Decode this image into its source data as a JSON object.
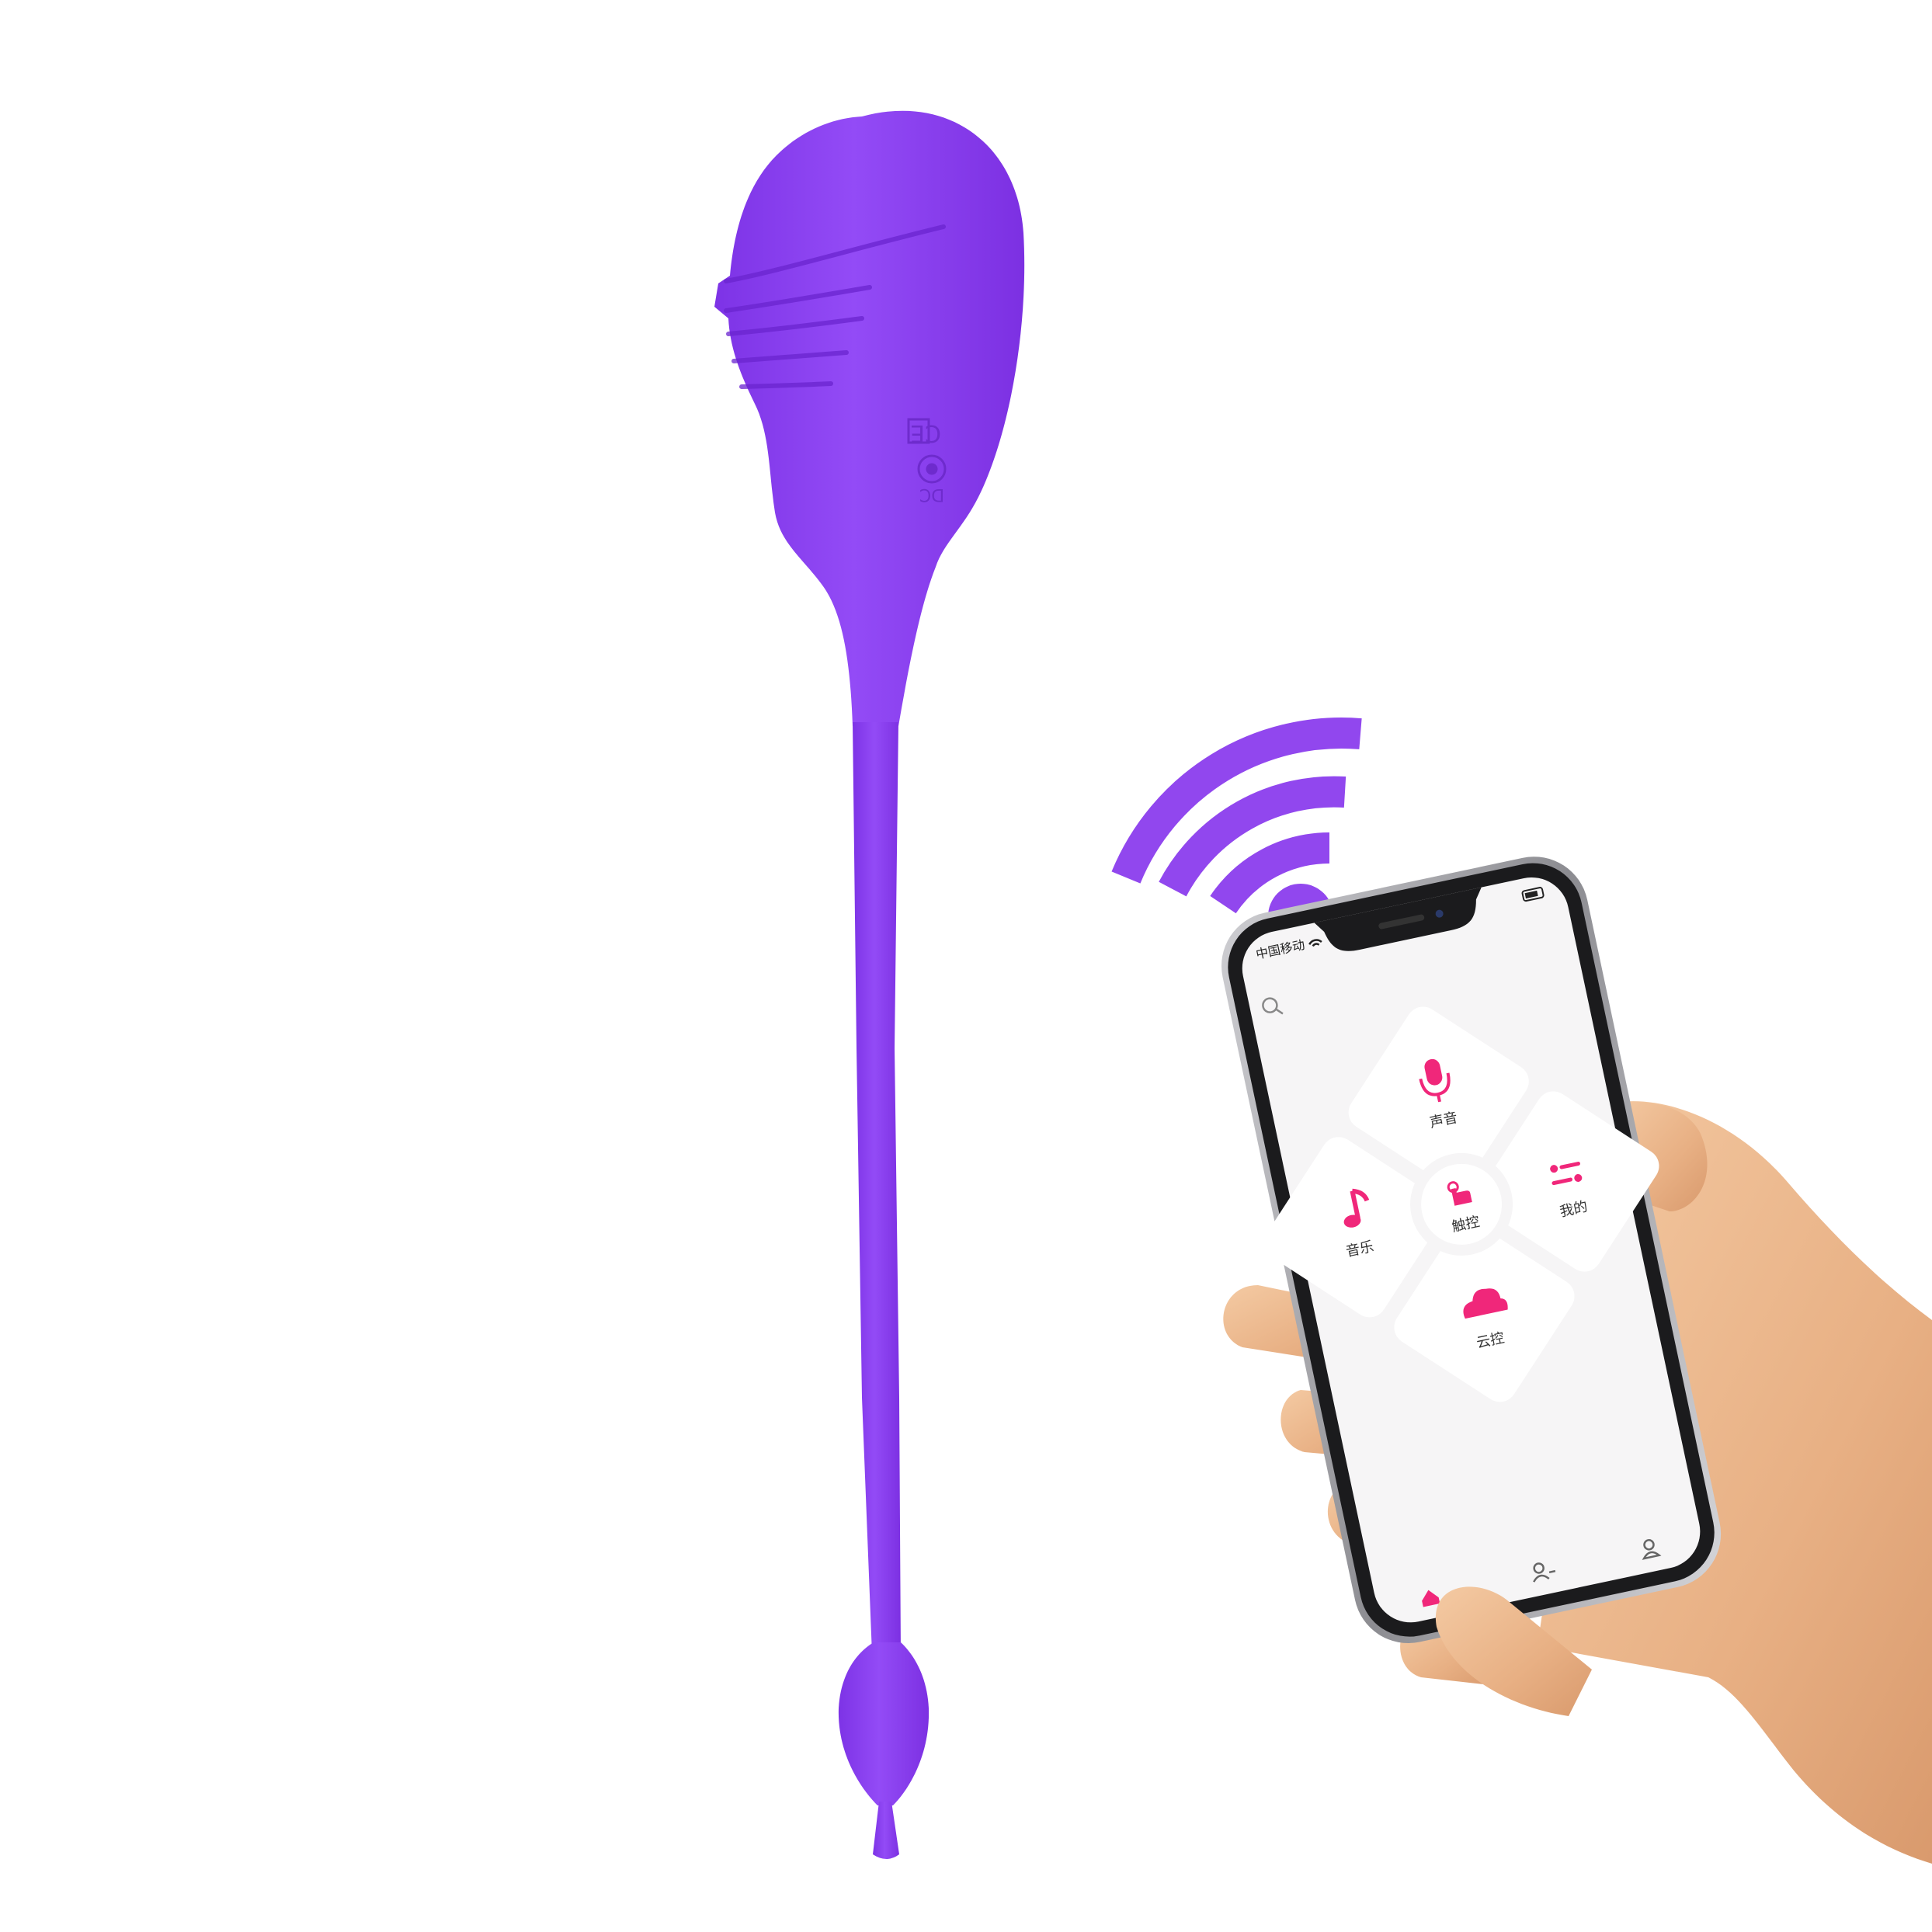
{
  "colors": {
    "product": "#8e42f3",
    "product_shade": "#7a2fe0",
    "wifi": "#9147ee",
    "accent": "#f0277a",
    "phone_body": "#1b1b1d",
    "screen_bg": "#f6f5f6",
    "tile_bg": "#ffffff",
    "skin": "#e9b78e"
  },
  "device": {
    "markings": {
      "ce": "CE",
      "dc": "DC"
    }
  },
  "phone": {
    "status_bar": {
      "carrier": "中国移动",
      "wifi_icon": "wifi-icon"
    },
    "tiles": {
      "voice": {
        "label": "声音",
        "icon": "microphone-icon"
      },
      "music": {
        "label": "音乐",
        "icon": "music-note-icon"
      },
      "touch": {
        "label": "触控",
        "icon": "touch-hand-icon"
      },
      "mine": {
        "label": "我的",
        "icon": "sliders-icon"
      },
      "cloud": {
        "label": "云控",
        "icon": "cloud-icon"
      }
    },
    "bottom_nav": {
      "home_icon": "home-icon",
      "friends_icon": "user-add-icon",
      "profile_icon": "user-icon"
    }
  }
}
